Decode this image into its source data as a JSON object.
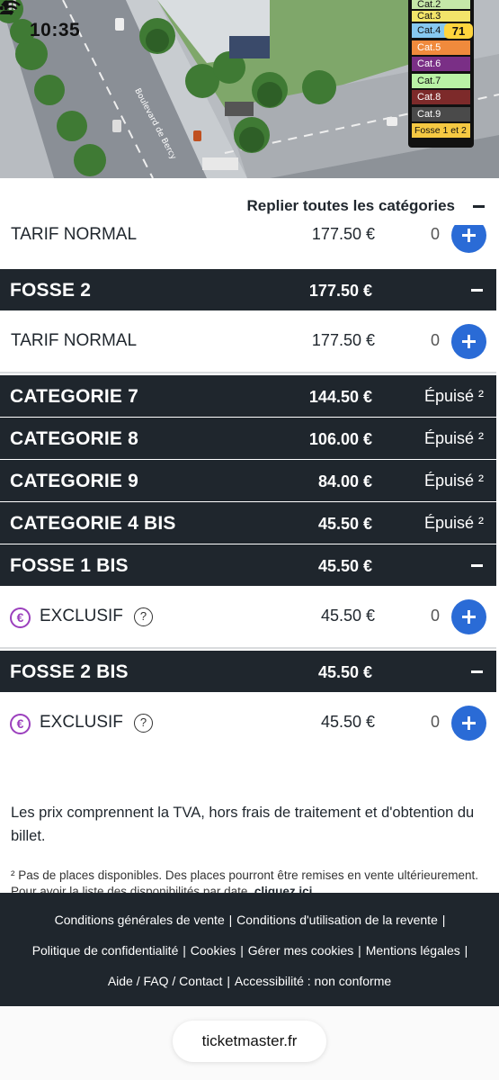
{
  "status_bar": {
    "time": "10:35",
    "battery": "71"
  },
  "map": {
    "street_label": "Boulevard de Bercy",
    "legend": [
      {
        "label": "Cat.2",
        "color": "#c5e8a8"
      },
      {
        "label": "Cat.3",
        "color": "#f3e46a"
      },
      {
        "label": "Cat.4",
        "color": "#86c8f0"
      },
      {
        "label": "Cat.5",
        "color": "#f08a3c"
      },
      {
        "label": "Cat.6",
        "color": "#7a2f86"
      },
      {
        "label": "Cat.7",
        "color": "#b9f2a5"
      },
      {
        "label": "Cat.8",
        "color": "#7d2a2a"
      },
      {
        "label": "Cat.9",
        "color": "#4a4a4a"
      },
      {
        "label": "Fosse 1 et 2",
        "color": "#f5c842"
      }
    ]
  },
  "collapse_all_label": "Replier toutes les catégories",
  "rows": [
    {
      "kind": "tarif",
      "name": "TARIF NORMAL",
      "price": "177.50 €",
      "qty": "0"
    },
    {
      "kind": "category",
      "name": "FOSSE 2",
      "price": "177.50 €",
      "state": "expanded"
    },
    {
      "kind": "tarif",
      "name": "TARIF NORMAL",
      "price": "177.50 €",
      "qty": "0"
    },
    {
      "kind": "category",
      "name": "CATEGORIE 7",
      "price": "144.50 €",
      "status": "Épuisé ²"
    },
    {
      "kind": "category",
      "name": "CATEGORIE 8",
      "price": "106.00 €",
      "status": "Épuisé ²"
    },
    {
      "kind": "category",
      "name": "CATEGORIE 9",
      "price": "84.00 €",
      "status": "Épuisé ²"
    },
    {
      "kind": "category",
      "name": "CATEGORIE 4 BIS",
      "price": "45.50 €",
      "status": "Épuisé ²"
    },
    {
      "kind": "category",
      "name": "FOSSE 1 BIS",
      "price": "45.50 €",
      "state": "expanded"
    },
    {
      "kind": "tarif",
      "name": "EXCLUSIF",
      "price": "45.50 €",
      "qty": "0",
      "help": "?"
    },
    {
      "kind": "category",
      "name": "FOSSE 2 BIS",
      "price": "45.50 €",
      "state": "expanded"
    },
    {
      "kind": "tarif",
      "name": "EXCLUSIF",
      "price": "45.50 €",
      "qty": "0",
      "help": "?"
    }
  ],
  "euro_symbol": "€",
  "info_text": "Les prix comprennent la TVA, hors frais de traitement et d'obtention du billet.",
  "footnote": {
    "text": "² Pas de places disponibles. Des places pourront être remises en vente ultérieurement. Pour avoir la liste des disponibilités par date, ",
    "link": "cliquez ici"
  },
  "footer": {
    "line1": [
      "Conditions générales de vente",
      "Conditions d'utilisation de la revente"
    ],
    "line2": [
      "Politique de confidentialité",
      "Cookies",
      "Gérer mes cookies",
      "Mentions légales"
    ],
    "line3": [
      "Aide / FAQ / Contact",
      "Accessibilité : non conforme"
    ]
  },
  "browser": {
    "url": "ticketmaster.fr"
  }
}
